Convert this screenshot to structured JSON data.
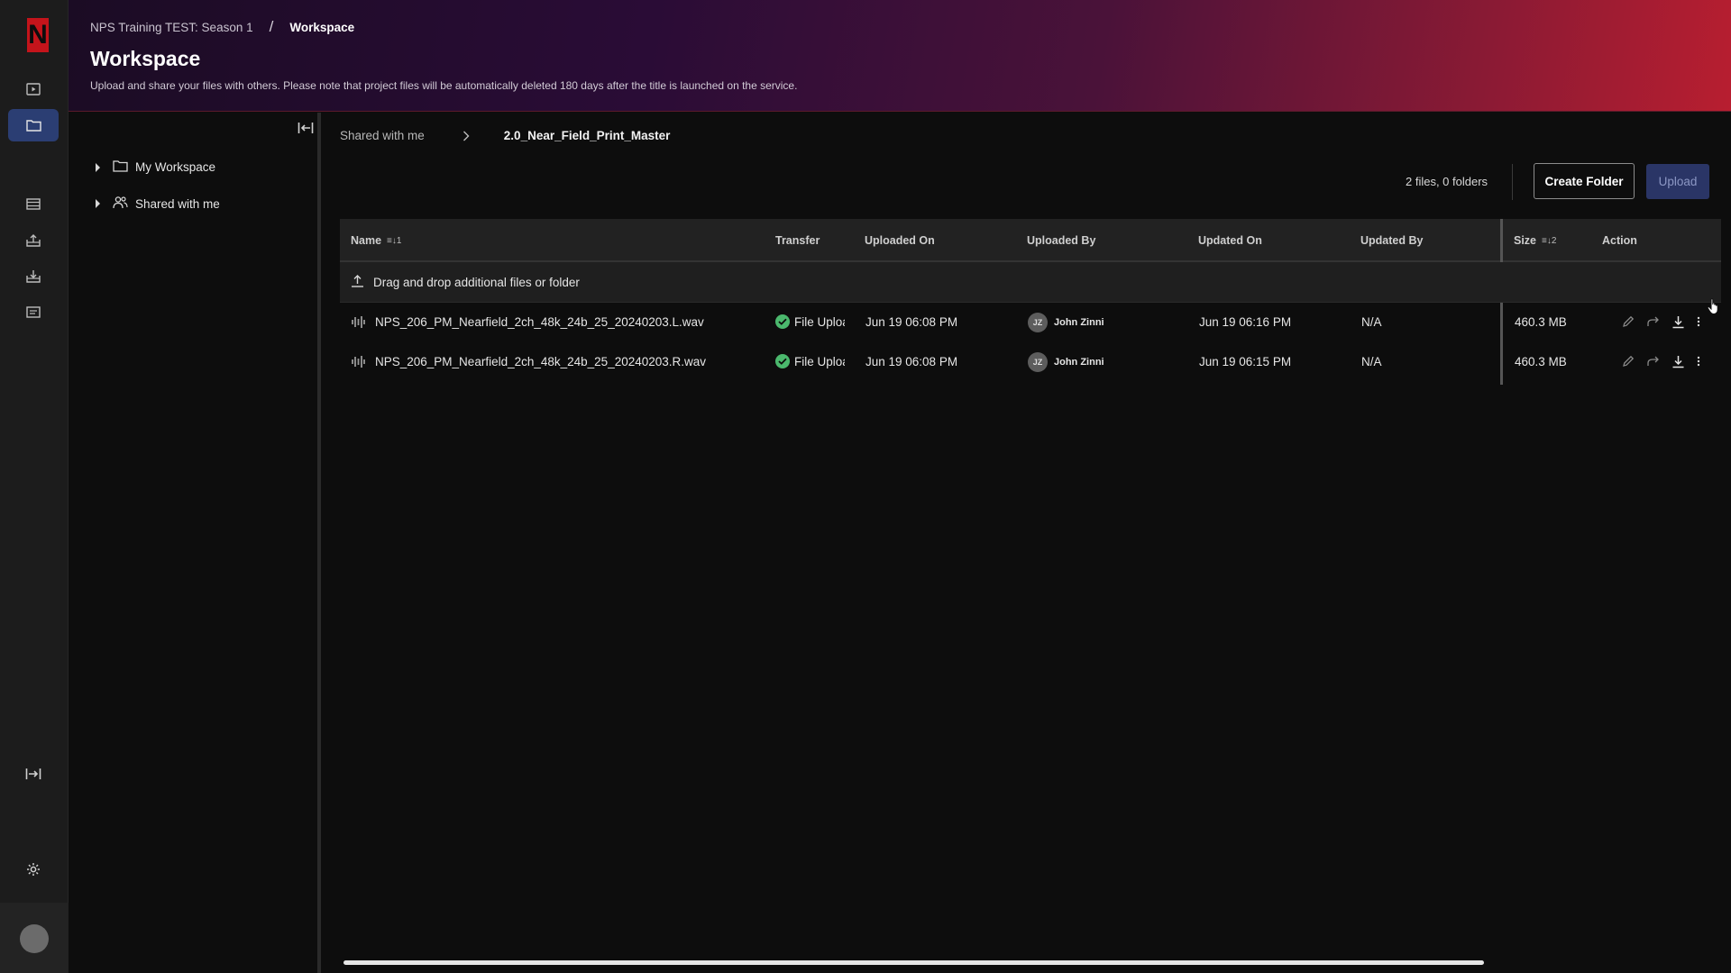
{
  "header": {
    "breadcrumb_parent": "NPS Training TEST: Season 1",
    "breadcrumb_separator": "/",
    "breadcrumb_current": "Workspace",
    "title": "Workspace",
    "subtitle": "Upload and share your files with others. Please note that project files will be automatically deleted 180 days after the title is launched on the service."
  },
  "logo": {
    "letter": "N",
    "color": "#c4141b"
  },
  "rail": {
    "icons": [
      "video-icon",
      "folder-icon",
      "film-icon",
      "inbox-upload-icon",
      "inbox-download-icon",
      "calendar-list-icon",
      "expand-icon",
      "gear-icon"
    ],
    "active": "folder-icon",
    "accent": "#2b3e73"
  },
  "tree": {
    "items": [
      {
        "label": "My Workspace",
        "icon": "folder-icon"
      },
      {
        "label": "Shared with me",
        "icon": "people-icon"
      }
    ]
  },
  "path": {
    "parent": "Shared with me",
    "current": "2.0_Near_Field_Print_Master"
  },
  "toolbar": {
    "counts": "2 files, 0 folders",
    "create_folder_label": "Create Folder",
    "upload_label": "Upload"
  },
  "table": {
    "columns": {
      "name": "Name",
      "name_sort": "1",
      "transfer": "Transfer",
      "uploaded_on": "Uploaded On",
      "uploaded_by": "Uploaded By",
      "updated_on": "Updated On",
      "updated_by": "Updated By",
      "size": "Size",
      "size_sort": "2",
      "action": "Action"
    },
    "dropzone_text": "Drag and drop additional files or folder",
    "rows": [
      {
        "name": "NPS_206_PM_Nearfield_2ch_48k_24b_25_20240203.L.wav",
        "transfer": "File Uploa",
        "uploaded_on": "Jun 19 06:08 PM",
        "uploaded_by_initials": "JZ",
        "uploaded_by": "John Zinni",
        "updated_on": "Jun 19 06:16 PM",
        "updated_by": "N/A",
        "size": "460.3 MB"
      },
      {
        "name": "NPS_206_PM_Nearfield_2ch_48k_24b_25_20240203.R.wav",
        "transfer": "File Uploa",
        "uploaded_on": "Jun 19 06:08 PM",
        "uploaded_by_initials": "JZ",
        "uploaded_by": "John Zinni",
        "updated_on": "Jun 19 06:15 PM",
        "updated_by": "N/A",
        "size": "460.3 MB"
      }
    ],
    "status_color": "#4bb86d"
  }
}
